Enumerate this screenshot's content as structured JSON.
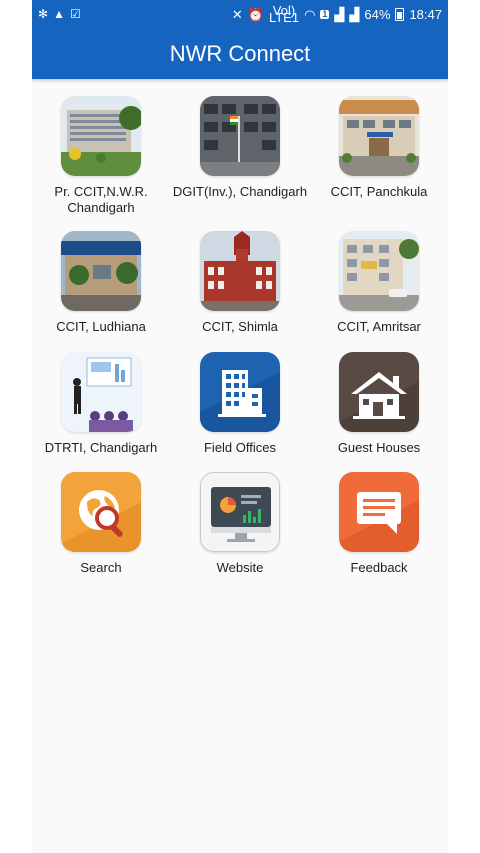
{
  "status_bar": {
    "left_icons": [
      "fan-icon",
      "warning-icon",
      "clipboard-icon"
    ],
    "volte_top": "Vol)",
    "volte_bottom": "LTE1",
    "sim_badge": "1",
    "battery_percent": "64%",
    "time": "18:47"
  },
  "app_bar": {
    "title": "NWR Connect"
  },
  "tiles": [
    {
      "label": "Pr. CCIT,N.W.R. Chandigarh",
      "icon": "office-building-photo-icon"
    },
    {
      "label": "DGIT(Inv.), Chandigarh",
      "icon": "government-building-photo-icon"
    },
    {
      "label": "CCIT, Panchkula",
      "icon": "panchkula-office-photo-icon"
    },
    {
      "label": "CCIT, Ludhiana",
      "icon": "ludhiana-office-photo-icon"
    },
    {
      "label": "CCIT, Shimla",
      "icon": "shimla-building-photo-icon"
    },
    {
      "label": "CCIT, Amritsar",
      "icon": "amritsar-office-photo-icon"
    },
    {
      "label": "DTRTI, Chandigarh",
      "icon": "training-presentation-icon"
    },
    {
      "label": "Field Offices",
      "icon": "office-building-icon"
    },
    {
      "label": "Guest Houses",
      "icon": "house-icon"
    },
    {
      "label": "Search",
      "icon": "globe-search-icon"
    },
    {
      "label": "Website",
      "icon": "monitor-chart-icon"
    },
    {
      "label": "Feedback",
      "icon": "feedback-message-icon"
    }
  ],
  "colors": {
    "app_bar": "#1565c0",
    "field_offices": "#1e63b0",
    "guest_houses": "#5a4a44",
    "search": "#f2a33a",
    "feedback": "#ef6c3a"
  }
}
